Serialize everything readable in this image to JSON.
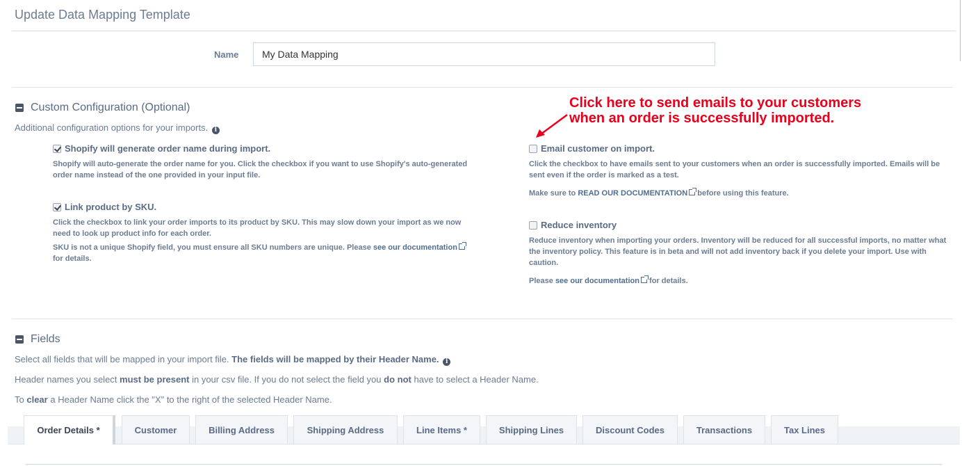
{
  "header": {
    "title": "Update Data Mapping Template"
  },
  "name_field": {
    "label": "Name",
    "value": "My Data Mapping"
  },
  "custom_config": {
    "title": "Custom Configuration (Optional)",
    "subtitle": "Additional configuration options for your imports.",
    "options": {
      "generate_name": {
        "label": "Shopify will generate order name during import.",
        "checked": true,
        "desc": "Shopify will auto-generate the order name for you. Click the checkbox if you want to use Shopify's auto-generated order name instead of the one provided in your input file."
      },
      "link_sku": {
        "label": "Link product by SKU.",
        "checked": true,
        "desc": "Click the checkbox to link your order imports to its product by SKU. This may slow down your import as we now need to look up product info for each order.",
        "note_prefix": "SKU is not a unique Shopify field, you must ensure all SKU numbers are unique. Please",
        "note_link": "see our documentation",
        "note_suffix": "for details."
      },
      "email_customer": {
        "label": "Email customer on import.",
        "checked": false,
        "desc": "Click the checkbox to have emails sent to your customers when an order is successfully imported. Emails will be sent even if the order is marked as a test.",
        "note_prefix": "Make sure to",
        "note_link": "READ OUR DOCUMENTATION",
        "note_suffix": "before using this feature."
      },
      "reduce_inventory": {
        "label": "Reduce inventory",
        "checked": false,
        "desc": "Reduce inventory when importing your orders. Inventory will be reduced for all successful imports, no matter what the inventory policy. This feature is in beta and will not add inventory back if you delete your import. Use with caution.",
        "note_prefix": "Please",
        "note_link": "see our documentation",
        "note_suffix": "for details."
      }
    }
  },
  "callout": {
    "line1": "Click here to send emails to your customers",
    "line2": "when an order is successfully imported.",
    "color": "#e8001c"
  },
  "fields": {
    "title": "Fields",
    "line1_a": "Select all fields that will be mapped in your import file.",
    "line1_b": "The fields will be mapped by their Header Name.",
    "line2_a": "Header names you select",
    "line2_b": "must be present",
    "line2_c": "in your csv file. If you do not select the field you",
    "line2_d": "do not",
    "line2_e": "have to select a Header Name.",
    "line3_a": "To",
    "line3_b": "clear",
    "line3_c": "a Header Name click the \"X\" to the right of the selected Header Name."
  },
  "tabs": [
    {
      "label": "Order Details *"
    },
    {
      "label": "Customer"
    },
    {
      "label": "Billing Address"
    },
    {
      "label": "Shipping Address"
    },
    {
      "label": "Line Items *"
    },
    {
      "label": "Shipping Lines"
    },
    {
      "label": "Discount Codes"
    },
    {
      "label": "Transactions"
    },
    {
      "label": "Tax Lines"
    }
  ]
}
